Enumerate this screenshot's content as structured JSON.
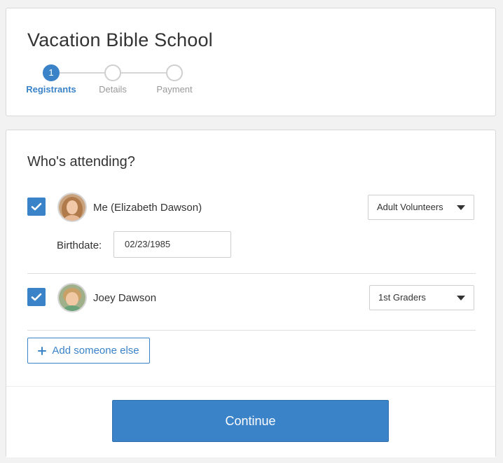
{
  "header": {
    "title": "Vacation Bible School",
    "steps": [
      {
        "number": "1",
        "label": "Registrants",
        "state": "active"
      },
      {
        "number": "",
        "label": "Details",
        "state": "inactive"
      },
      {
        "number": "",
        "label": "Payment",
        "state": "inactive"
      }
    ]
  },
  "registrants": {
    "section_title": "Who's attending?",
    "people": [
      {
        "name": "Me (Elizabeth Dawson)",
        "checked": true,
        "group": "Adult Volunteers",
        "birthdate_label": "Birthdate:",
        "birthdate_value": "02/23/1985"
      },
      {
        "name": "Joey Dawson",
        "checked": true,
        "group": "1st Graders"
      }
    ],
    "add_label": "Add someone else",
    "continue_label": "Continue"
  },
  "colors": {
    "accent": "#3a83c8",
    "background": "#f2f2f2",
    "border": "#d9d9d9"
  },
  "icons": {
    "checkbox": "check-icon",
    "add": "plus-icon",
    "dropdown": "caret-down-icon"
  }
}
